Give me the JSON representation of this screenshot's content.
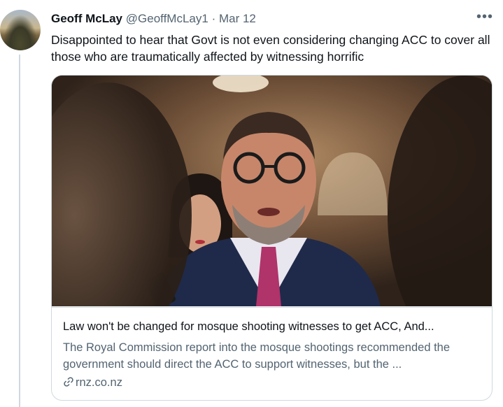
{
  "tweet": {
    "author_name": "Geoff McLay",
    "handle": "@GeoffMcLay1",
    "separator": "·",
    "date": "Mar 12",
    "more_label": "•••",
    "text": "Disappointed to hear that Govt is not even considering changing ACC to cover all those who are traumatically affected by witnessing horrific"
  },
  "card": {
    "title": "Law won't be changed for mosque shooting witnesses to get ACC, And...",
    "description": "The Royal Commission report into the mosque shootings recommended the government should direct the ACC to support witnesses, but the ...",
    "domain": "rnz.co.nz",
    "link_icon": "🔗"
  }
}
